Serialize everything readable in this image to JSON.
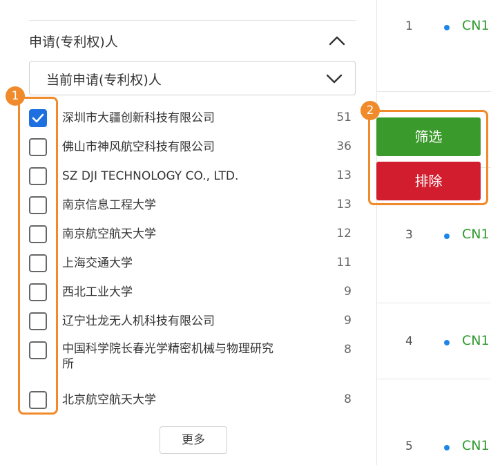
{
  "filter": {
    "section_title": "申请(专利权)人",
    "select_value": "当前申请(专利权)人",
    "items": [
      {
        "label": "深圳市大疆创新科技有限公司",
        "count": "51",
        "checked": true
      },
      {
        "label": "佛山市神风航空科技有限公司",
        "count": "36",
        "checked": false
      },
      {
        "label": "SZ DJI TECHNOLOGY CO., LTD.",
        "count": "13",
        "checked": false
      },
      {
        "label": "南京信息工程大学",
        "count": "13",
        "checked": false
      },
      {
        "label": "南京航空航天大学",
        "count": "12",
        "checked": false
      },
      {
        "label": "上海交通大学",
        "count": "11",
        "checked": false
      },
      {
        "label": "西北工业大学",
        "count": "9",
        "checked": false
      },
      {
        "label": "辽宁壮龙无人机科技有限公司",
        "count": "9",
        "checked": false
      },
      {
        "label": "中国科学院长春光学精密机械与物理研究所",
        "count": "8",
        "checked": false
      },
      {
        "label": "北京航空航天大学",
        "count": "8",
        "checked": false
      }
    ],
    "more_label": "更多"
  },
  "actions": {
    "filter_label": "筛选",
    "exclude_label": "排除"
  },
  "annotations": {
    "badge_1": "1",
    "badge_2": "2"
  },
  "results": [
    {
      "index": "1",
      "code": "CN1"
    },
    {
      "index": "3",
      "code": "CN1"
    },
    {
      "index": "4",
      "code": "CN1"
    },
    {
      "index": "5",
      "code": "CN1"
    }
  ],
  "icons": {
    "collapse": "chevron-up-icon",
    "select_arrow": "chevron-down-icon",
    "check": "check-icon",
    "result_bullet": "dot-icon"
  },
  "colors": {
    "filter_button": "#3a9a2b",
    "exclude_button": "#d21d2f",
    "annotation": "#f08a2a",
    "checkbox_checked": "#1e6fe0",
    "result_code": "#2f9a2f",
    "result_bullet": "#1e86e8"
  }
}
